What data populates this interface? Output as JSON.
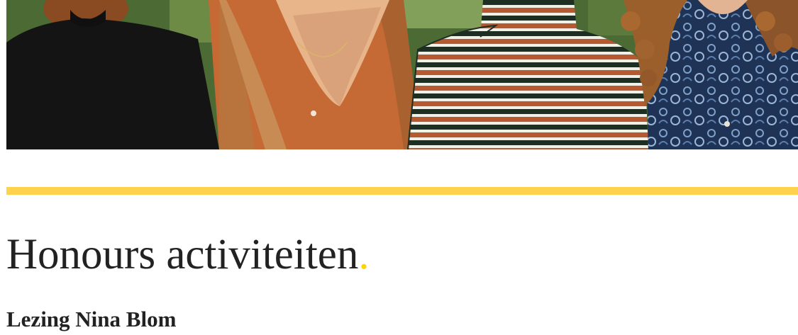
{
  "hero": {
    "image": "group photo of four women sitting side by side (black, rust, striped, paisley tops)"
  },
  "colors": {
    "accent": "#ffd24d",
    "title_dot": "#ffd200",
    "text": "#222222"
  },
  "section": {
    "title": "Honours activiteiten",
    "title_dot": "."
  },
  "activity": {
    "title": "Lezing Nina Blom"
  }
}
